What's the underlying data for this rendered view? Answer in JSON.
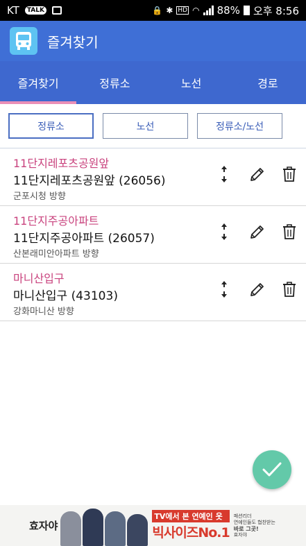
{
  "status_bar": {
    "carrier": "KT",
    "talk_badge": "TALK",
    "battery": "88%",
    "time": "오후 8:56",
    "hd_label": "HD"
  },
  "app_bar": {
    "title": "즐겨찾기"
  },
  "tabs": [
    {
      "label": "즐겨찾기",
      "active": true
    },
    {
      "label": "정류소",
      "active": false
    },
    {
      "label": "노선",
      "active": false
    },
    {
      "label": "경로",
      "active": false
    }
  ],
  "filters": [
    {
      "label": "정류소",
      "active": true
    },
    {
      "label": "노선",
      "active": false
    },
    {
      "label": "정류소/노선",
      "active": false
    }
  ],
  "favorites": [
    {
      "alias": "11단지레포츠공원앞",
      "stop": "11단지레포츠공원앞 (26056)",
      "direction": "군포시청 방향"
    },
    {
      "alias": "11단지주공아파트",
      "stop": "11단지주공아파트 (26057)",
      "direction": "산본래미안아파트 방향"
    },
    {
      "alias": "마니산입구",
      "stop": "마니산입구 (43103)",
      "direction": "강화마니산 방향"
    }
  ],
  "ad": {
    "brand": "효자야",
    "headline": "TV에서 본 연예인 옷",
    "big_text": "빅사이즈No.1",
    "side_line1": "패션리더",
    "side_line2": "연예인들도 협찬받는",
    "side_line3": "바로 그곳!",
    "side_brand": "효자야"
  },
  "colors": {
    "app_bar": "#3f6fd6",
    "tab_bar": "#3e68cf",
    "tab_indicator": "#ea8fb7",
    "alias_text": "#c9437e",
    "fab": "#63c9a9"
  },
  "icons": {
    "move": "up-down-arrows-icon",
    "edit": "pencil-icon",
    "delete": "trash-icon",
    "fab": "check-icon",
    "app_logo": "bus-icon"
  }
}
